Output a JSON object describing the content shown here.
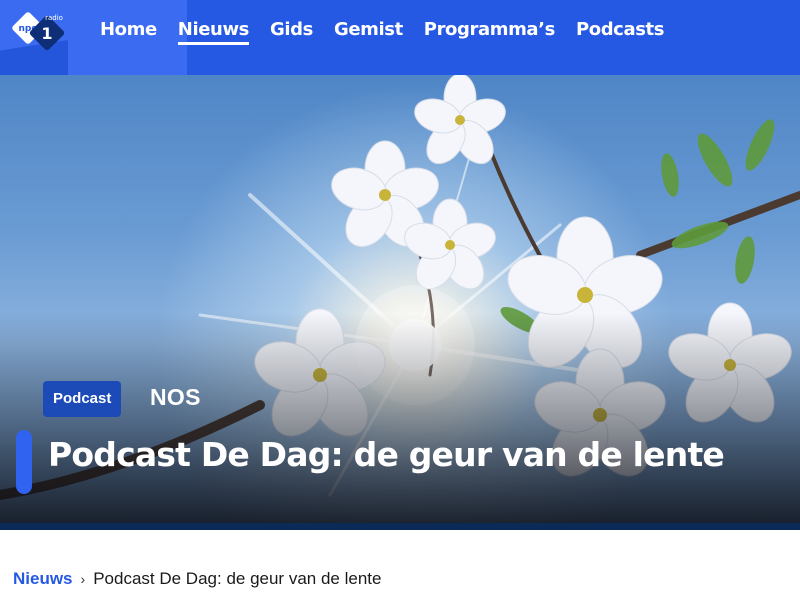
{
  "logo": {
    "top_text": "npo",
    "side_text": "radio",
    "numeral": "1",
    "icon": "npo-radio-1-logo"
  },
  "nav": {
    "items": [
      {
        "label": "Home",
        "active": false
      },
      {
        "label": "Nieuws",
        "active": true
      },
      {
        "label": "Gids",
        "active": false
      },
      {
        "label": "Gemist",
        "active": false
      },
      {
        "label": "Programma’s",
        "active": false
      },
      {
        "label": "Podcasts",
        "active": false
      }
    ]
  },
  "hero": {
    "badge": "Podcast",
    "brand": "NOS",
    "title": "Podcast De Dag: de geur van de lente",
    "image_subject": "cherry-blossom-sun-image"
  },
  "breadcrumb": {
    "parent": "Nieuws",
    "separator": "›",
    "current": "Podcast De Dag: de geur van de lente"
  },
  "colors": {
    "nav_bg": "#2559e3",
    "accent": "#2f63f0",
    "badge_bg": "#1c4bb8",
    "link": "#2559e3"
  }
}
